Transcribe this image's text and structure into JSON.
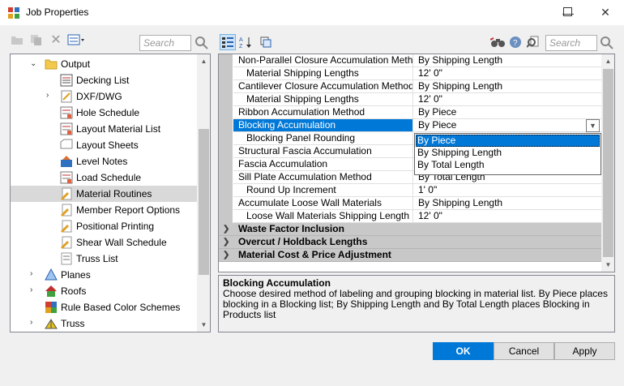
{
  "window": {
    "title": "Job Properties"
  },
  "left_toolbar": {
    "search_placeholder": "Search"
  },
  "right_toolbar": {
    "search_placeholder": "Search"
  },
  "tree": {
    "items": [
      {
        "label": "Output",
        "icon": "folder-open-icon",
        "expanded": true
      },
      {
        "label": "Decking List",
        "icon": "report-icon"
      },
      {
        "label": "DXF/DWG",
        "icon": "dxf-icon",
        "expandable": true
      },
      {
        "label": "Hole Schedule",
        "icon": "schedule-icon"
      },
      {
        "label": "Layout Material List",
        "icon": "schedule-icon"
      },
      {
        "label": "Layout Sheets",
        "icon": "sheets-icon"
      },
      {
        "label": "Level Notes",
        "icon": "notes-icon"
      },
      {
        "label": "Load Schedule",
        "icon": "schedule-icon"
      },
      {
        "label": "Material Routines",
        "icon": "material-icon",
        "selected": true
      },
      {
        "label": "Member Report Options",
        "icon": "material-icon"
      },
      {
        "label": "Positional Printing",
        "icon": "material-icon"
      },
      {
        "label": "Shear Wall Schedule",
        "icon": "material-icon"
      },
      {
        "label": "Truss List",
        "icon": "truss-list-icon"
      },
      {
        "label": "Planes",
        "icon": "planes-icon",
        "expandable": true
      },
      {
        "label": "Roofs",
        "icon": "roofs-icon",
        "expandable": true
      },
      {
        "label": "Rule Based Color Schemes",
        "icon": "color-scheme-icon"
      },
      {
        "label": "Truss",
        "icon": "truss-icon",
        "expandable": true
      }
    ]
  },
  "grid": {
    "rows": [
      {
        "name": "Non-Parallel Closure Accumulation Method",
        "value": "By Shipping Length"
      },
      {
        "name": "Material Shipping Lengths",
        "value": "12' 0\"",
        "indent": true
      },
      {
        "name": "Cantilever Closure Accumulation Method",
        "value": "By Shipping Length"
      },
      {
        "name": "Material Shipping Lengths",
        "value": "12' 0\"",
        "indent": true
      },
      {
        "name": "Ribbon Accumulation Method",
        "value": "By Piece"
      },
      {
        "name": "Blocking Accumulation",
        "value": "By Piece",
        "selected": true
      },
      {
        "name": "Blocking Panel Rounding",
        "value": "",
        "indent": true
      },
      {
        "name": "Structural Fascia Accumulation",
        "value": ""
      },
      {
        "name": "Fascia Accumulation",
        "value": ""
      },
      {
        "name": "Sill Plate Accumulation Method",
        "value": "By Total Length"
      },
      {
        "name": "Round Up Increment",
        "value": "1' 0\"",
        "indent": true
      },
      {
        "name": "Accumulate Loose Wall Materials",
        "value": "By Shipping Length"
      },
      {
        "name": "Loose Wall Materials Shipping Length",
        "value": "12' 0\"",
        "indent": true
      }
    ],
    "categories": [
      "Waste Factor Inclusion",
      "Overcut / Holdback Lengths",
      "Material Cost & Price Adjustment"
    ]
  },
  "dropdown": {
    "options": [
      "By Piece",
      "By Shipping Length",
      "By Total Length"
    ],
    "selected": "By Piece"
  },
  "description": {
    "title": "Blocking Accumulation",
    "text": "Choose desired method of labeling and grouping blocking in material list.  By Piece places blocking in a Blocking list; By Shipping Length and By Total Length places Blocking in Products list"
  },
  "buttons": {
    "ok": "OK",
    "cancel": "Cancel",
    "apply": "Apply"
  },
  "colors": {
    "accent": "#0078d7",
    "selection": "#d9d9d9",
    "category_bg": "#c8c8c8"
  }
}
